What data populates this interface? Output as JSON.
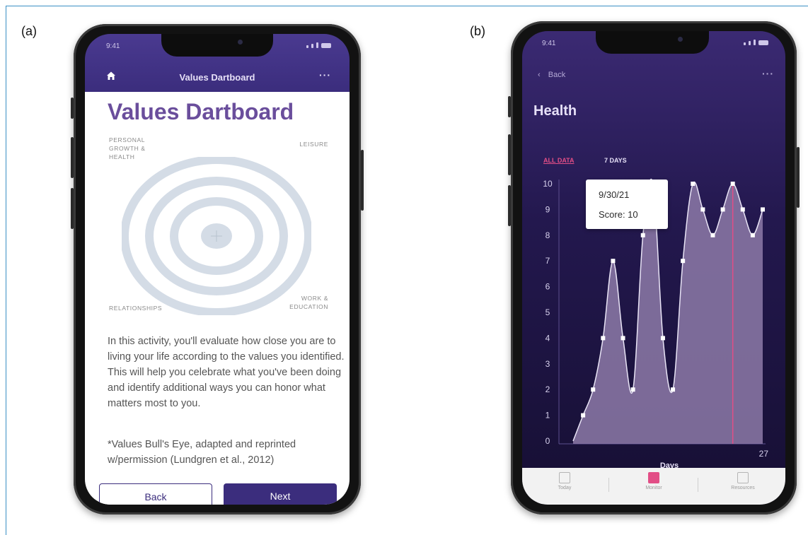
{
  "labels": {
    "a": "(a)",
    "b": "(b)"
  },
  "colors": {
    "accent": "#3b2d7d",
    "title": "#6a4e9c",
    "chart_fill": "#8d7aa8",
    "highlight": "#e24e86",
    "frame_border": "#3a8fc4"
  },
  "phone_a": {
    "status": {
      "time": "9:41"
    },
    "header": {
      "title": "Values Dartboard",
      "home_icon": "home-icon",
      "menu_icon": "more-icon"
    },
    "page_title": "Values Dartboard",
    "dartboard": {
      "quadrants": {
        "top_left": [
          "PERSONAL",
          "GROWTH &",
          "HEALTH"
        ],
        "top_right": "LEISURE",
        "bottom_left": "RELATIONSHIPS",
        "bottom_right": [
          "WORK &",
          "EDUCATION"
        ]
      },
      "ring_count": 4
    },
    "description": "In this activity, you'll evaluate how close you are to living your life according to the values you identified. This will help you celebrate what you've been doing and identify additional ways you can honor what matters most to you.",
    "citation": "*Values Bull's Eye, adapted and reprinted w/permission (Lundgren et al., 2012)",
    "buttons": {
      "back": "Back",
      "next": "Next"
    }
  },
  "phone_b": {
    "status": {
      "time": "9:41"
    },
    "back_label": "Back",
    "menu_icon": "more-icon",
    "title": "Health",
    "filters": {
      "all": "ALL DATA",
      "seven": "7 DAYS",
      "active": "all"
    },
    "tooltip": {
      "date": "9/30/21",
      "score": "Score: 10"
    },
    "x_axis": {
      "label": "Days",
      "end_tick": "27"
    },
    "tabs": [
      {
        "label": "Today",
        "icon": "calendar-icon"
      },
      {
        "label": "Monitor",
        "icon": "chart-icon",
        "active": true
      },
      {
        "label": "Resources",
        "icon": "grid-icon"
      }
    ]
  },
  "chart_data": {
    "type": "area",
    "xlabel": "Days",
    "ylabel": "",
    "ylim": [
      0,
      10
    ],
    "y_ticks": [
      "0",
      "1",
      "2",
      "3",
      "4",
      "5",
      "6",
      "7",
      "8",
      "9",
      "10"
    ],
    "x_tick_labels": [
      "27"
    ],
    "highlight_index": 16,
    "points": [
      0,
      1,
      2,
      4,
      7,
      4,
      2,
      8,
      10,
      4,
      2,
      7,
      10,
      9,
      8,
      9,
      10,
      9,
      8,
      9
    ],
    "grid": false,
    "legend": "none"
  }
}
